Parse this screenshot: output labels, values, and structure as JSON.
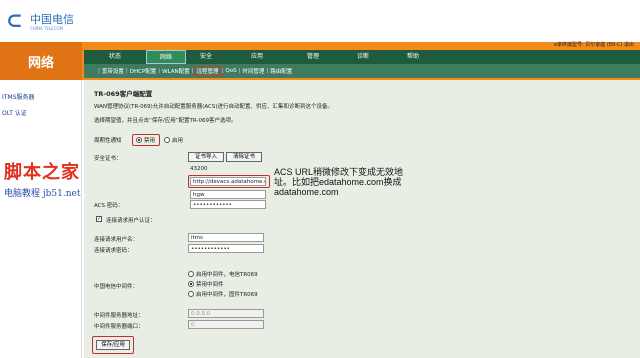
{
  "header": {
    "logo_mark": "⊂",
    "logo_text": "中国电信",
    "logo_sub": "CHINA TELECOM",
    "section_title": "网络",
    "device_info": "e家终端型号: 贝尔家庭 (E8-C)   退出"
  },
  "nav": {
    "tabs": [
      "状态",
      "网络",
      "安全",
      "应用",
      "管理",
      "诊断",
      "帮助"
    ],
    "active_tab": "网络"
  },
  "subnav": {
    "items": [
      "宽带设置",
      "DHCP配置",
      "WLAN配置",
      "远程管理",
      "QoS",
      "时间管理",
      "路由配置"
    ],
    "active_item": "远程管理"
  },
  "sidebar": {
    "items": [
      "ITMS服务器",
      "OLT 认证"
    ]
  },
  "form": {
    "title": "TR-069客户端配置",
    "desc1": "WAN管理协议(TR-069)允许自动配置服务器(ACS)进行自动配置、供应、汇集和诊断到这个设备。",
    "desc2": "选择期望值，并且点击“保存/应用”配置TR-069客户选项。",
    "periodic_label": "周期性通知",
    "periodic_options": [
      "禁用",
      "启用"
    ],
    "periodic_value": "禁用",
    "security_label": "安全证书：",
    "cert_import": "证书导入",
    "cert_clear": "清除证书",
    "interval_value": "43200",
    "url_value": "http://devacs.adatahome.c",
    "username_value": "hgw",
    "acs_password_label": "ACS 密码：",
    "acs_password_value": "••••••••••••",
    "conn_auth_label": "连接请求用户认证：",
    "conn_auth_checked": "✓",
    "conn_user_label": "连接请求用户名：",
    "conn_user_value": "itms",
    "conn_pass_label": "连接请求密码：",
    "conn_pass_value": "••••••••••••",
    "middleware_label": "中国电信中间件：",
    "middleware_options": [
      "启用中间件，电信TR069",
      "禁用中间件",
      "启用中间件，固件TR069"
    ],
    "middleware_value": "禁用中间件",
    "mw_addr_label": "中间件服务器地址：",
    "mw_addr_value": "0.0.0.0",
    "mw_port_label": "中间件服务器端口：",
    "mw_port_value": "0",
    "save_button": "保存/应用"
  },
  "annotation": {
    "line1": "ACS URL稍微修改下变成无效地",
    "line2": "址。比如把edatahome.com换成",
    "line3": "adatahome.com"
  },
  "watermark": {
    "line1": "脚本之家",
    "line2": "电脑教程 jb51.net"
  },
  "colors": {
    "orange": "#f28a1e",
    "nav_green": "#1f5c3d",
    "content_bg": "#e8eee4",
    "highlight_red": "#c0302a"
  }
}
